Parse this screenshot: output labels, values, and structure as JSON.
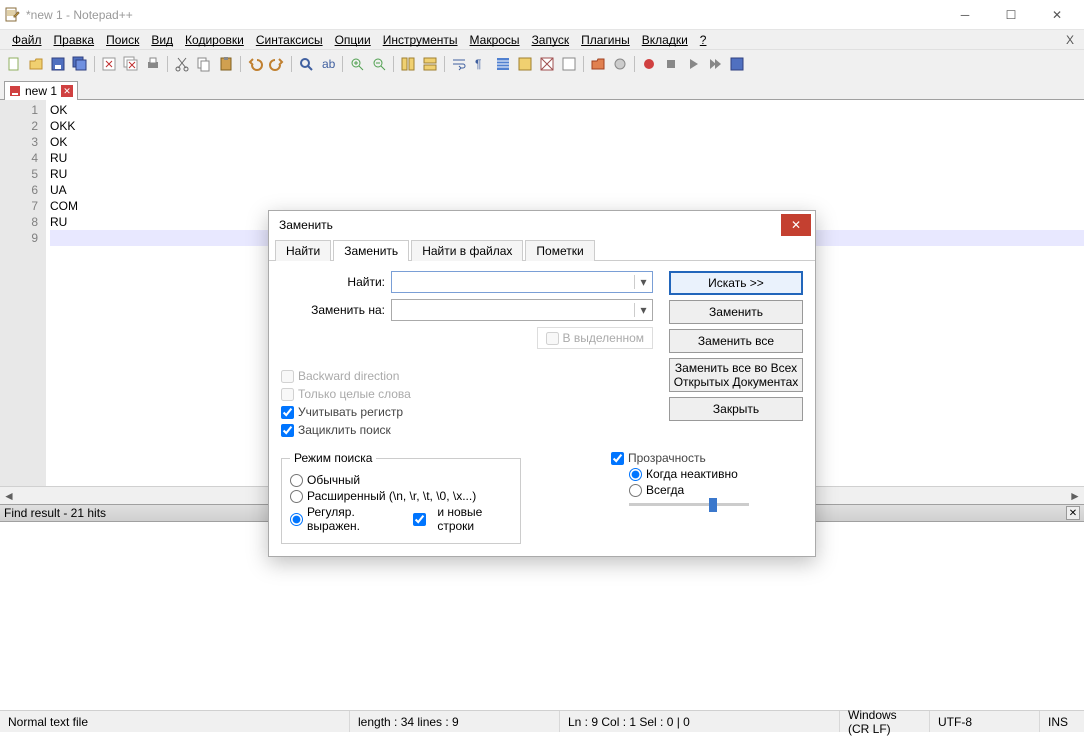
{
  "window": {
    "title": "*new 1 - Notepad++"
  },
  "menu": {
    "items": [
      "Файл",
      "Правка",
      "Поиск",
      "Вид",
      "Кодировки",
      "Синтаксисы",
      "Опции",
      "Инструменты",
      "Макросы",
      "Запуск",
      "Плагины",
      "Вкладки",
      "?"
    ]
  },
  "tab": {
    "name": "new 1"
  },
  "editor": {
    "lines": [
      "OK",
      "OKK",
      "OK",
      "RU",
      "RU",
      "UA",
      "COM",
      "RU",
      ""
    ]
  },
  "find_panel": {
    "header": "Find result - 21 hits"
  },
  "status": {
    "doc_type": "Normal text file",
    "length_lines": "length : 34    lines : 9",
    "pos": "Ln : 9    Col : 1    Sel : 0 | 0",
    "eol": "Windows (CR LF)",
    "encoding": "UTF-8",
    "mode": "INS"
  },
  "dialog": {
    "title": "Заменить",
    "tabs": [
      "Найти",
      "Заменить",
      "Найти в файлах",
      "Пометки"
    ],
    "active_tab": 1,
    "find_label": "Найти:",
    "replace_label": "Заменить на:",
    "in_selection": "В выделенном",
    "chk_backward": "Backward direction",
    "chk_whole": "Только целые слова",
    "chk_case": "Учитывать регистр",
    "chk_wrap": "Зациклить поиск",
    "search_mode_legend": "Режим поиска",
    "rad_normal": "Обычный",
    "rad_extended": "Расширенный (\\n, \\r, \\t, \\0, \\x...)",
    "rad_regex": "Регуляр. выражен.",
    "chk_dotall": "и новые строки",
    "chk_trans": "Прозрачность",
    "rad_inactive": "Когда неактивно",
    "rad_always": "Всегда",
    "btn_find": "Искать >>",
    "btn_replace": "Заменить",
    "btn_replace_all": "Заменить все",
    "btn_replace_all_docs": "Заменить все во Всех Открытых Документах",
    "btn_close": "Закрыть"
  }
}
